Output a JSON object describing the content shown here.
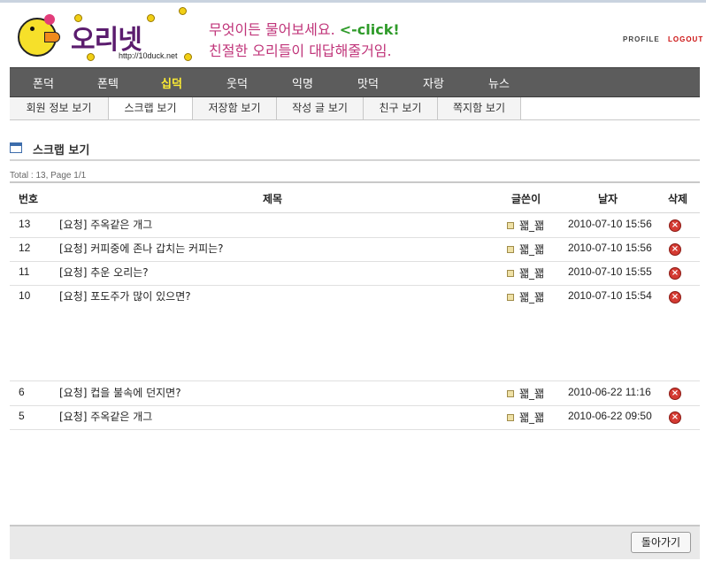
{
  "header": {
    "logo_text": "오리넷",
    "logo_url": "http://10duck.net",
    "slogan_line1": "무엇이든 물어보세요.",
    "slogan_click": "<-click!",
    "slogan_line2": "친절한 오리들이 대답해줄거임.",
    "profile_label": "PROFILE",
    "logout_label": "LOGOUT"
  },
  "main_nav": [
    "폰덕",
    "폰텍",
    "십덕",
    "웃덕",
    "익명",
    "맛덕",
    "자랑",
    "뉴스"
  ],
  "main_nav_active": "십덕",
  "sub_nav": [
    "회원 정보 보기",
    "스크랩 보기",
    "저장함 보기",
    "작성 글 보기",
    "친구 보기",
    "쪽지함 보기"
  ],
  "sub_nav_active": "스크랩 보기",
  "section_title": "스크랩 보기",
  "total_text": "Total : 13, Page 1/1",
  "table": {
    "headers": {
      "num": "번호",
      "title": "제목",
      "writer": "글쓴이",
      "date": "날자",
      "delete": "삭제"
    },
    "rows": [
      {
        "num": "13",
        "title": "[요청] 주옥같은 개그",
        "writer": "꽯_꽯",
        "date": "2010-07-10 15:56"
      },
      {
        "num": "12",
        "title": "[요청] 커피중에 존나 갑치는 커피는?",
        "writer": "꽯_꽯",
        "date": "2010-07-10 15:56"
      },
      {
        "num": "11",
        "title": "[요청] 추운 오리는?",
        "writer": "꽯_꽯",
        "date": "2010-07-10 15:55"
      },
      {
        "num": "10",
        "title": "[요청] 포도주가 많이 있으면?",
        "writer": "꽯_꽯",
        "date": "2010-07-10 15:54"
      },
      {
        "num": "6",
        "title": "[요청] 컵을 불속에 던지면?",
        "writer": "꽯_꽯",
        "date": "2010-06-22 11:16"
      },
      {
        "num": "5",
        "title": "[요청] 주옥같은 개그",
        "writer": "꽯_꽯",
        "date": "2010-06-22 09:50"
      }
    ]
  },
  "footer": {
    "back_label": "돌아가기"
  },
  "colors": {
    "nav_bg": "#5c5c5c",
    "nav_active": "#ffee33",
    "slogan": "#c0357a",
    "logout": "#cc1111"
  }
}
